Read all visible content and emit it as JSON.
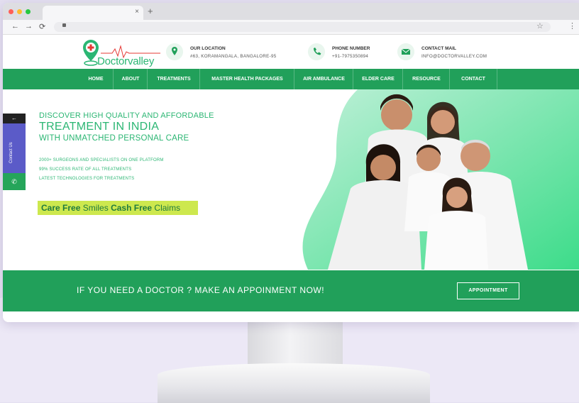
{
  "browser": {
    "tab_close": "×",
    "new_tab": "+",
    "nav_icons": [
      "←",
      "→",
      "⟳"
    ],
    "bookmark_icon": "☆",
    "menu_icon": "⋮",
    "dot_colors": [
      "#ff5f57",
      "#febc2e",
      "#28c840"
    ]
  },
  "site": {
    "logo_text": "Doctorvalley",
    "header": {
      "location_label": "OUR LOCATION",
      "location_value": "#63, KORAMANGALA, BANGALORE-95",
      "phone_label": "PHONE NUMBER",
      "phone_value": "+91-7975350894",
      "mail_label": "CONTACT MAIL",
      "mail_value": "INFO@DOCTORVALLEY.COM"
    },
    "nav": [
      "HOME",
      "ABOUT",
      "TREATMENTS",
      "MASTER HEALTH PACKAGES",
      "AIR AMBULANCE",
      "ELDER CARE",
      "RESOURCE",
      "CONTACT"
    ],
    "hero": {
      "line1": "DISCOVER HIGH QUALITY AND AFFORDABLE",
      "line2": "TREATMENT IN INDIA",
      "line3": "WITH UNMATCHED PERSONAL CARE",
      "bullets": [
        "2000+ SURGEONS AND SPECIALISTS ON ONE PLATFORM",
        "99% SUCCESS RATE OF ALL TREATMENTS",
        "LATEST TECHNOLOGIES FOR TREATMENTS"
      ],
      "care_bold1": "Care Free",
      "care_reg1": " Smiles ",
      "care_bold2": "Cash Free",
      "care_reg2": " Claims"
    },
    "side_tab": {
      "arrow": "←",
      "label": "Contact Us",
      "whatsapp": "✆"
    },
    "cta": {
      "text": "IF YOU NEED A DOCTOR ? MAKE AN APPOINMENT NOW!",
      "button": "APPOINTMENT"
    }
  },
  "colors": {
    "brand_green": "#21a05a",
    "text_green": "#2bb673",
    "highlight": "#cde84e",
    "side_purple": "#5b5bc8"
  }
}
